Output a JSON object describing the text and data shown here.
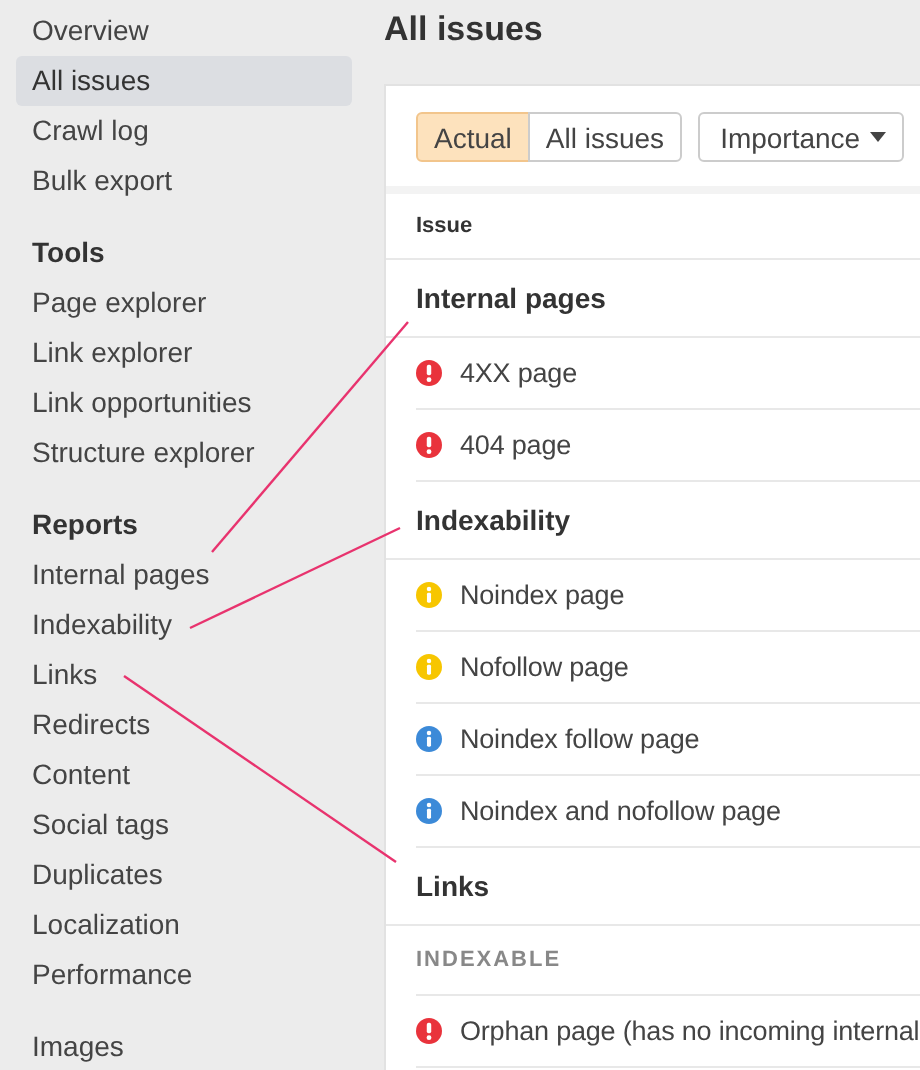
{
  "sidebar": {
    "groups": [
      {
        "items": [
          {
            "label": "Overview",
            "selected": false
          },
          {
            "label": "All issues",
            "selected": true
          },
          {
            "label": "Crawl log",
            "selected": false
          },
          {
            "label": "Bulk export",
            "selected": false
          }
        ]
      },
      {
        "heading": "Tools",
        "items": [
          {
            "label": "Page explorer",
            "selected": false
          },
          {
            "label": "Link explorer",
            "selected": false
          },
          {
            "label": "Link opportunities",
            "selected": false
          },
          {
            "label": "Structure explorer",
            "selected": false
          }
        ]
      },
      {
        "heading": "Reports",
        "items": [
          {
            "label": "Internal pages",
            "selected": false
          },
          {
            "label": "Indexability",
            "selected": false
          },
          {
            "label": "Links",
            "selected": false
          },
          {
            "label": "Redirects",
            "selected": false
          },
          {
            "label": "Content",
            "selected": false
          },
          {
            "label": "Social tags",
            "selected": false
          },
          {
            "label": "Duplicates",
            "selected": false
          },
          {
            "label": "Localization",
            "selected": false
          },
          {
            "label": "Performance",
            "selected": false
          }
        ]
      },
      {
        "items": [
          {
            "label": "Images",
            "selected": false
          }
        ]
      }
    ]
  },
  "page_title": "All issues",
  "filter": {
    "segments": [
      {
        "label": "Actual",
        "selected": true
      },
      {
        "label": "All issues",
        "selected": false
      }
    ],
    "dropdown": "Importance"
  },
  "table": {
    "column": "Issue",
    "rows": [
      {
        "kind": "section",
        "label": "Internal pages"
      },
      {
        "kind": "issue",
        "color": "#e9333c",
        "exclamation": true,
        "label": "4XX page"
      },
      {
        "kind": "issue",
        "color": "#e9333c",
        "exclamation": true,
        "label": "404 page"
      },
      {
        "kind": "section",
        "label": "Indexability"
      },
      {
        "kind": "issue",
        "color": "#f7c600",
        "exclamation": false,
        "label": "Noindex page"
      },
      {
        "kind": "issue",
        "color": "#f7c600",
        "exclamation": false,
        "label": "Nofollow page"
      },
      {
        "kind": "issue",
        "color": "#3c8ad8",
        "exclamation": false,
        "label": "Noindex follow page"
      },
      {
        "kind": "issue",
        "color": "#3c8ad8",
        "exclamation": false,
        "label": "Noindex and nofollow page"
      },
      {
        "kind": "section",
        "label": "Links"
      },
      {
        "kind": "subsection",
        "label": "INDEXABLE"
      },
      {
        "kind": "issue",
        "color": "#e9333c",
        "exclamation": true,
        "label": "Orphan page (has no incoming internal"
      }
    ]
  }
}
